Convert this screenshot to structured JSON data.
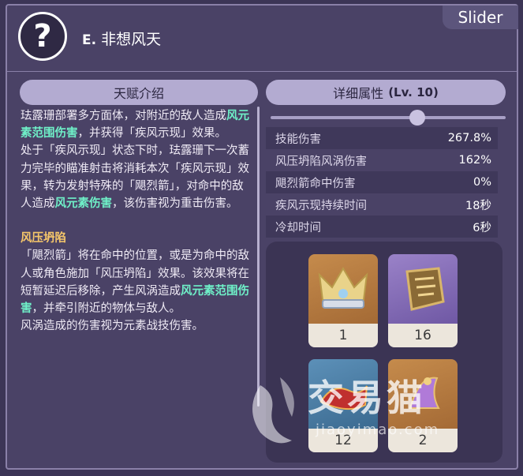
{
  "header": {
    "avatar_glyph": "?",
    "skill_key": "E.",
    "skill_name": "非想风天",
    "slider_label": "Slider"
  },
  "tabs": {
    "talent_intro": "天赋介绍",
    "detail_label": "详细属性",
    "detail_level": "(Lv. 10)"
  },
  "description": {
    "p1_a": "珐露珊部署多方面体，对附近的敌人造成",
    "p1_hl": "风元素范围伤害",
    "p1_b": "，并获得「疾风示现」效果。",
    "p2_a": "处于「疾风示现」状态下时，珐露珊下一次蓄力完毕的瞄准射击将消耗本次「疾风示现」效果，转为发射特殊的「飓烈箭」，对命中的敌人造成",
    "p2_hl": "风元素伤害",
    "p2_b": "，该伤害视为重击伤害。",
    "sub_title": "风压坍陷",
    "p3_a": "「飓烈箭」将在命中的位置，或是为命中的敌人或角色施加「风压坍陷」效果。该效果将在短暂延迟后移除，产生风涡造成",
    "p3_hl": "风元素范围伤害",
    "p3_b": "，并牵引附近的物体与敌人。",
    "p4": "风涡造成的伤害视为元素战技伤害。"
  },
  "slider": {
    "level": 10
  },
  "stats": [
    {
      "label": "技能伤害",
      "value": "267.8%"
    },
    {
      "label": "风压坍陷风涡伤害",
      "value": "162%"
    },
    {
      "label": "飓烈箭命中伤害",
      "value": "0%"
    },
    {
      "label": "疾风示现持续时间",
      "value": "18秒"
    },
    {
      "label": "冷却时间",
      "value": "6秒"
    }
  ],
  "materials": [
    {
      "icon": "crown-icon",
      "count": "1"
    },
    {
      "icon": "scroll-fragment-icon",
      "count": "16"
    },
    {
      "icon": "red-relic-icon",
      "count": "12"
    },
    {
      "icon": "purple-relic-icon",
      "count": "2"
    }
  ],
  "watermark": {
    "text": "交易猫",
    "url": "jiaoyimao.com"
  },
  "colors": {
    "background": "#3c3556",
    "panel": "#4a4266",
    "highlight": "#6ff0c8",
    "subtitle": "#f5c66a",
    "pill": "#b3abd1"
  }
}
